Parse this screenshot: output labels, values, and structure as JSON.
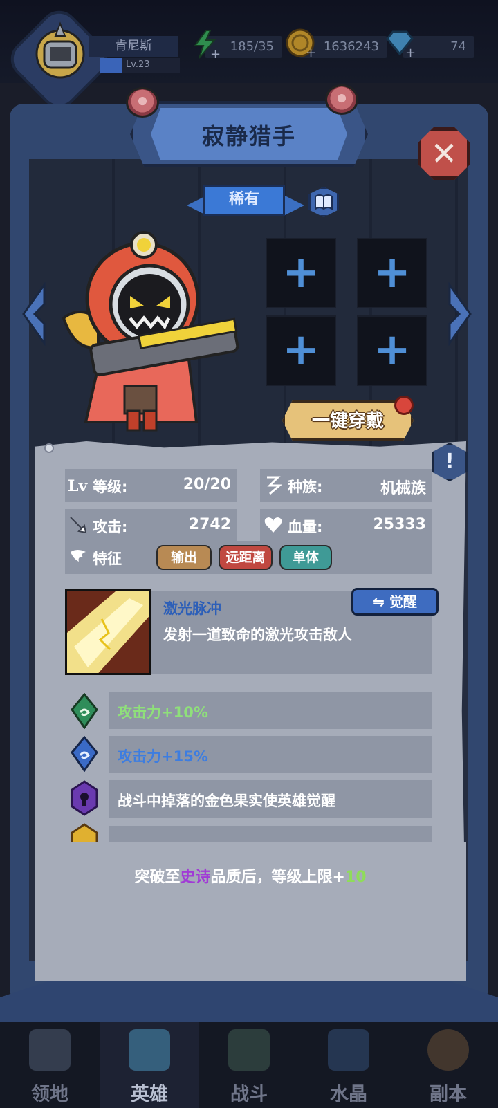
{
  "player": {
    "name": "肯尼斯",
    "level": "Lv.23"
  },
  "resources": {
    "energy": "185/35",
    "gold": "1636243",
    "gems": "74"
  },
  "hero": {
    "name": "寂静猎手",
    "rarity": "稀有"
  },
  "equip_all": {
    "label": "一键穿戴"
  },
  "stats": {
    "level_label": "等级:",
    "level_value": "20/20",
    "race_label": "种族:",
    "race_value": "机械族",
    "attack_label": "攻击:",
    "attack_value": "2742",
    "hp_label": "血量:",
    "hp_value": "25333",
    "traits_label": "特征"
  },
  "traits": [
    "输出",
    "远距离",
    "单体"
  ],
  "skill": {
    "name": "激光脉冲",
    "desc": "发射一道致命的激光攻击敌人",
    "awaken_label": "觉醒"
  },
  "perks": [
    {
      "text": "攻击力+10%",
      "color": "#8fe07a"
    },
    {
      "text": "攻击力+15%",
      "color": "#3d7de0"
    },
    {
      "text": "战斗中掉落的金色果实使英雄觉醒",
      "color": "#ffffff"
    }
  ],
  "breakthrough": {
    "prefix": "突破至",
    "quality": "史诗",
    "middle": "品质后，等级上限+",
    "amount": "10"
  },
  "nav": [
    "领地",
    "英雄",
    "战斗",
    "水晶",
    "副本"
  ],
  "colors": {
    "frame": "#31476f",
    "panel": "#a6acb9",
    "accent": "#3b79d6",
    "gold_button": "#e6c27a"
  },
  "icons": [
    "gear-helmet-avatar-icon",
    "energy-bolt-icon",
    "gold-coin-icon",
    "diamond-icon",
    "close-icon",
    "book-icon",
    "plus-icon",
    "level-icon",
    "race-icon",
    "sword-icon",
    "heart-icon",
    "wing-icon",
    "exclamation-icon"
  ]
}
